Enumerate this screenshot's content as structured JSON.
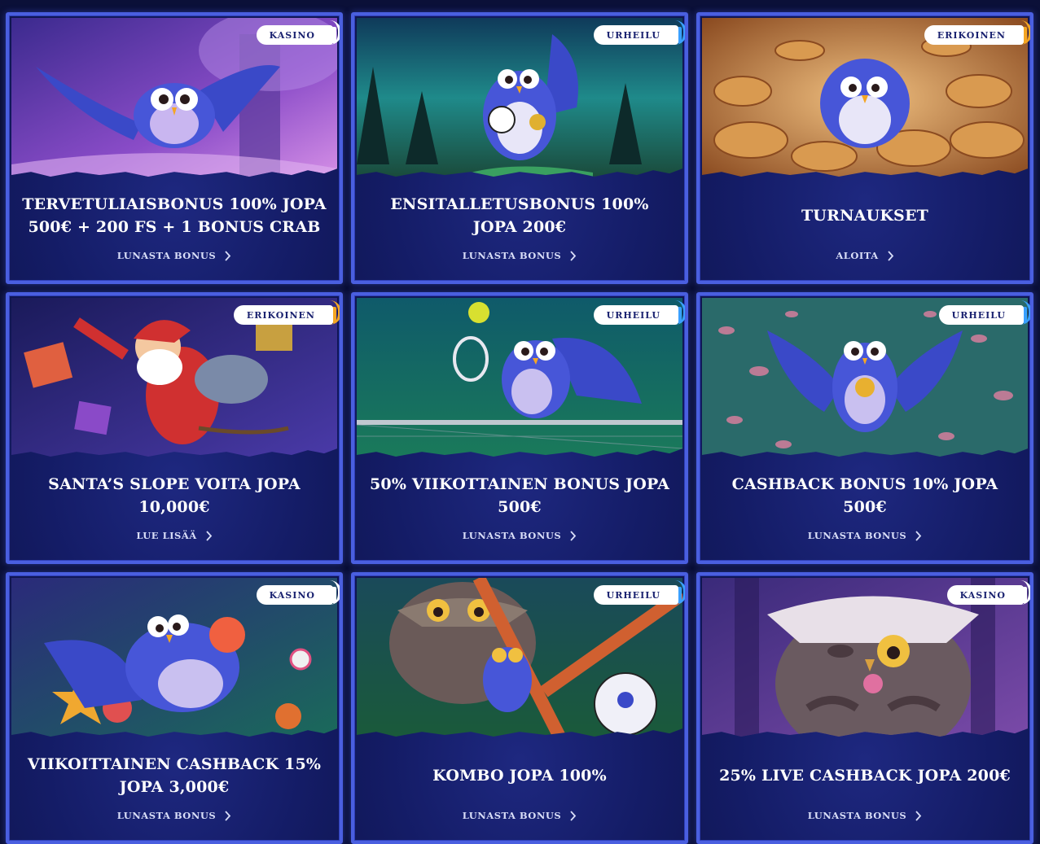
{
  "accents": {
    "kasino": "#ffffff",
    "urheilu": "#3aa0ff",
    "erikoinen": "#f5a623"
  },
  "cards": [
    {
      "badge": "KASINO",
      "badge_type": "kasino",
      "title": "TERVETULIAISBONUS 100% JOPA 500€ + 200 FS + 1 BONUS CRAB",
      "link": "LUNASTA BONUS",
      "art": "purple-forest-owl-flying"
    },
    {
      "badge": "URHEILU",
      "badge_type": "urheilu",
      "title": "ENSITALLETUSBONUS 100% JOPA 200€",
      "link": "LUNASTA BONUS",
      "art": "owl-soccer-medal-aurora"
    },
    {
      "badge": "ERIKOINEN",
      "badge_type": "erikoinen",
      "title": "TURNAUKSET",
      "link": "ALOITA",
      "art": "owl-golden-cups"
    },
    {
      "badge": "ERIKOINEN",
      "badge_type": "erikoinen",
      "title": "SANTA’S SLOPE VOITA JOPA 10,000€",
      "link": "LUE LISÄÄ",
      "art": "santa-with-gifts"
    },
    {
      "badge": "URHEILU",
      "badge_type": "urheilu",
      "title": "50% VIIKOTTAINEN BONUS JOPA 500€",
      "link": "LUNASTA BONUS",
      "art": "owl-tennis"
    },
    {
      "badge": "URHEILU",
      "badge_type": "urheilu",
      "title": "CASHBACK BONUS 10% JOPA 500€",
      "link": "LUNASTA BONUS",
      "art": "owl-leaves-medal"
    },
    {
      "badge": "KASINO",
      "badge_type": "kasino",
      "title": "VIIKOITTAINEN CASHBACK 15% JOPA 3,000€",
      "link": "LUNASTA BONUS",
      "art": "owl-candy"
    },
    {
      "badge": "URHEILU",
      "badge_type": "urheilu",
      "title": "KOMBO JOPA 100%",
      "link": "LUNASTA BONUS",
      "art": "owls-soccer-ball"
    },
    {
      "badge": "KASINO",
      "badge_type": "kasino",
      "title": "25% LIVE CASHBACK JOPA 200€",
      "link": "LUNASTA BONUS",
      "art": "big-owl-lollipop"
    }
  ]
}
